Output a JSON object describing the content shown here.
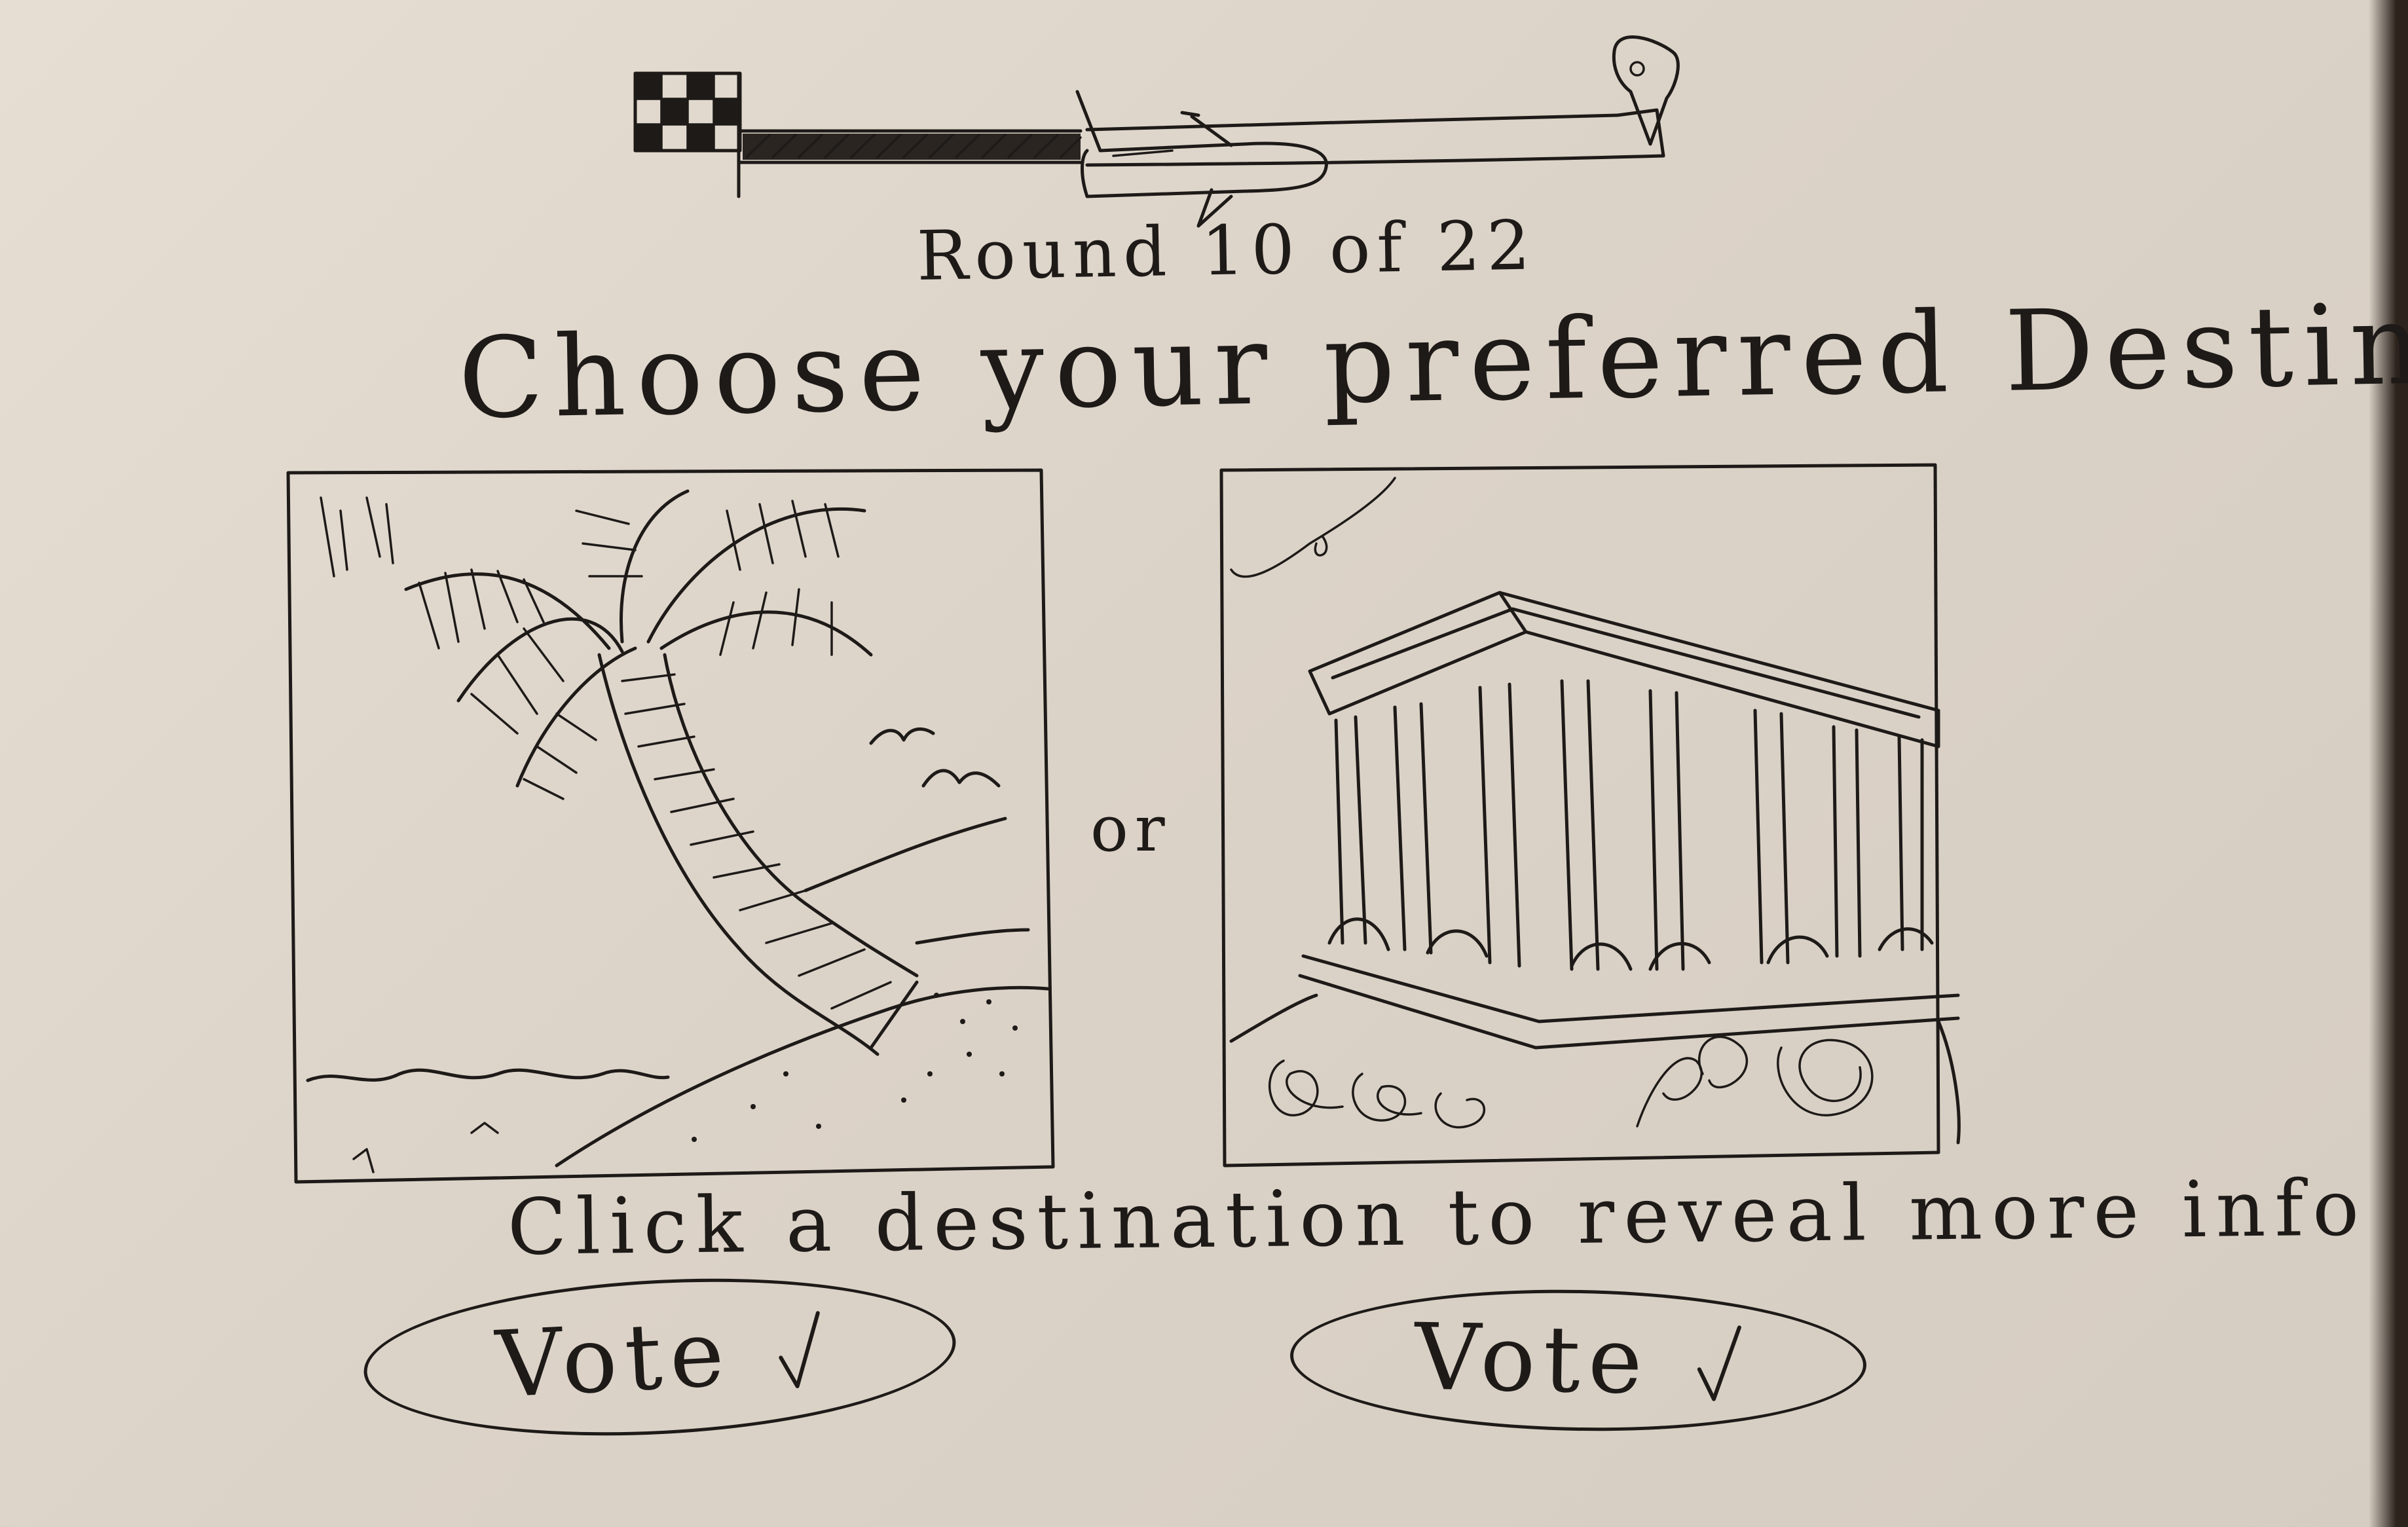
{
  "progress": {
    "round_label": "Round 10 of 22",
    "current_round": 10,
    "total_rounds": 22
  },
  "heading": "Choose your preferred Destination",
  "destinations": [
    {
      "scene": "beach",
      "icon": "palm-tree-beach-icon"
    },
    {
      "scene": "temple",
      "icon": "greek-temple-icon"
    }
  ],
  "separator": "or",
  "hint": "Click a destination to reveal more info",
  "vote_buttons": [
    {
      "label": "Vote",
      "icon": "checkmark-icon"
    },
    {
      "label": "Vote",
      "icon": "checkmark-icon"
    }
  ],
  "colors": {
    "paper": "#e3dbd0",
    "ink": "#1d1a18"
  }
}
